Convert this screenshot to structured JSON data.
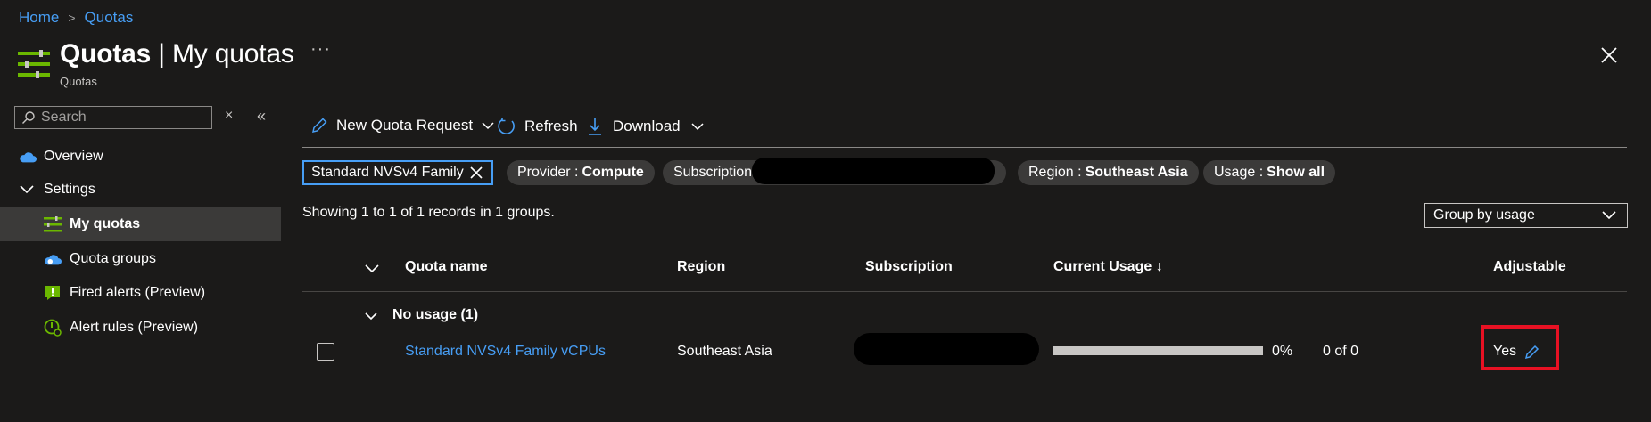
{
  "breadcrumb": {
    "home": "Home",
    "separator": ">",
    "current": "Quotas"
  },
  "header": {
    "title_main": "Quotas",
    "title_rest": " | My quotas",
    "subtitle": "Quotas",
    "more": "···",
    "close": "✕"
  },
  "sidebar": {
    "search_placeholder": "Search",
    "clear": "×",
    "collapse": "«",
    "items": [
      {
        "label": "Overview"
      },
      {
        "label": "Settings"
      },
      {
        "label": "My quotas"
      },
      {
        "label": "Quota groups"
      },
      {
        "label": "Fired alerts (Preview)"
      },
      {
        "label": "Alert rules (Preview)"
      }
    ]
  },
  "toolbar": {
    "new_request": "New Quota Request",
    "refresh": "Refresh",
    "download": "Download"
  },
  "filters": {
    "search_value": "Standard NVSv4 Family",
    "provider_label": "Provider :",
    "provider_value": "Compute",
    "subscription_label": "Subscription",
    "region_label": "Region :",
    "region_value": "Southeast Asia",
    "usage_label": "Usage :",
    "usage_value": "Show all"
  },
  "records_text": "Showing 1 to 1 of 1 records in 1 groups.",
  "group_by": "Group by usage",
  "table": {
    "headers": {
      "quota_name": "Quota name",
      "region": "Region",
      "subscription": "Subscription",
      "current_usage": "Current Usage ↓",
      "adjustable": "Adjustable"
    },
    "group_label": "No usage (1)",
    "rows": [
      {
        "quota_name": "Standard NVSv4 Family vCPUs",
        "region": "Southeast Asia",
        "usage_percent": "0%",
        "usage_fraction": 0,
        "usage_count": "0 of 0",
        "adjustable": "Yes"
      }
    ]
  },
  "colors": {
    "accent": "#479ef5",
    "background": "#1b1a19",
    "highlight": "#e81123",
    "icon_green": "#6bb700"
  }
}
